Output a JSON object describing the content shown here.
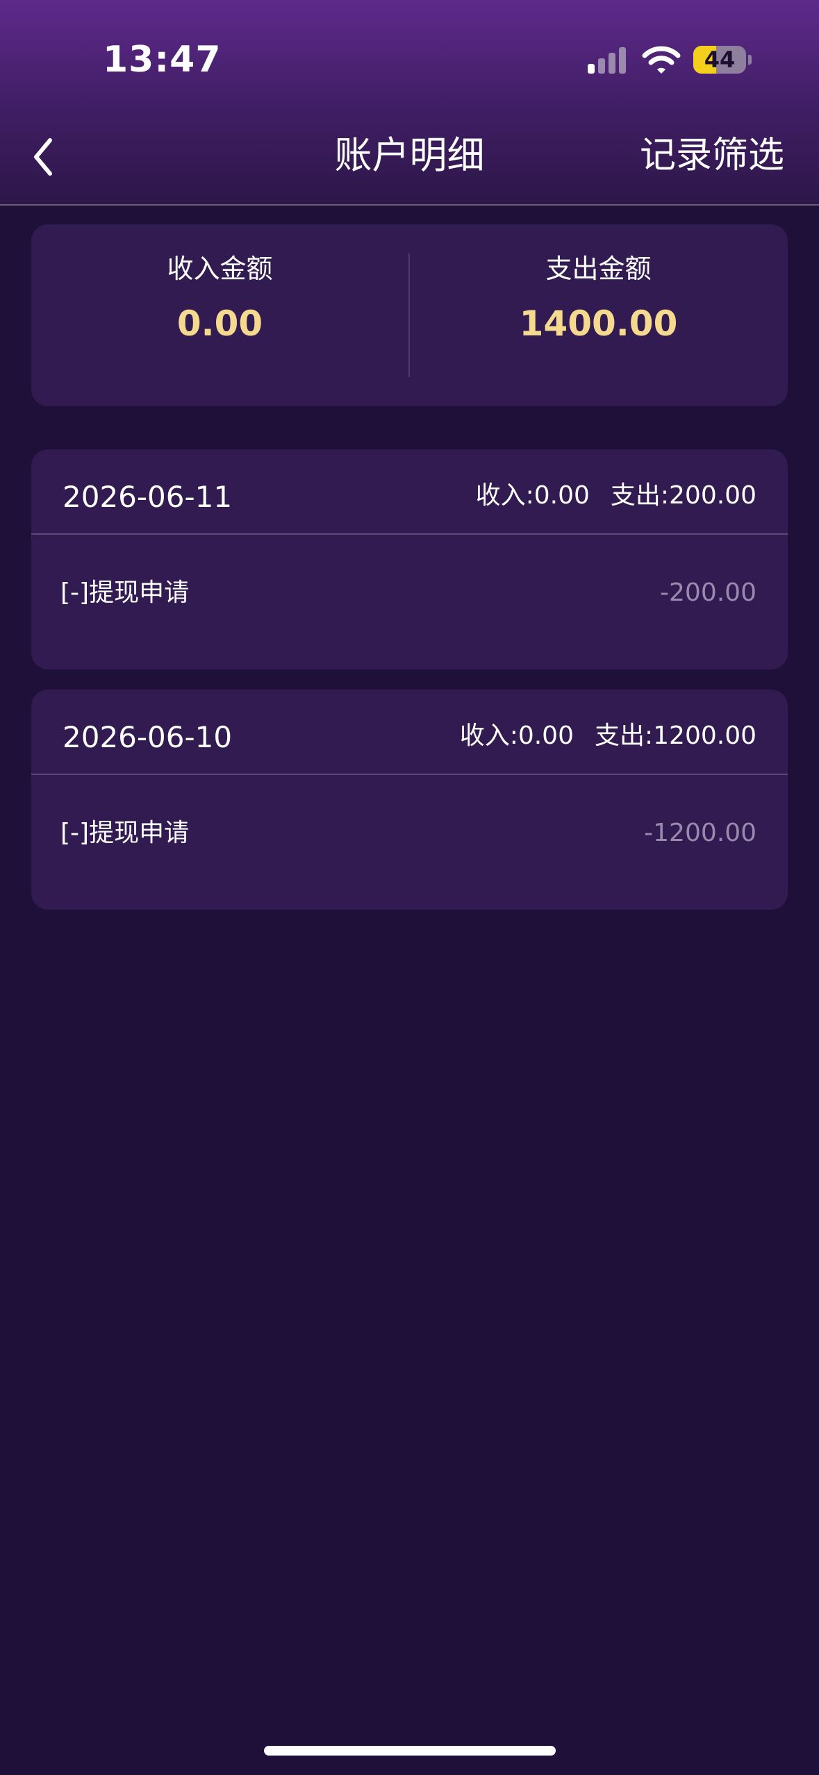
{
  "status_bar": {
    "time": "13:47",
    "battery_level": "44",
    "icons": [
      "signal-icon",
      "wifi-icon",
      "battery-icon"
    ]
  },
  "nav": {
    "back_icon": "chevron-left-icon",
    "title": "账户明细",
    "filter_label": "记录筛选"
  },
  "summary": {
    "income_label": "收入金额",
    "income_value": "0.00",
    "expense_label": "支出金额",
    "expense_value": "1400.00"
  },
  "records": [
    {
      "date": "2026-06-11",
      "income_summary": "收入:0.00",
      "expense_summary": "支出:200.00",
      "items": [
        {
          "description": "[-]提现申请",
          "amount": "-200.00"
        }
      ]
    },
    {
      "date": "2026-06-10",
      "income_summary": "收入:0.00",
      "expense_summary": "支出:1200.00",
      "items": [
        {
          "description": "[-]提现申请",
          "amount": "-1200.00"
        }
      ]
    }
  ],
  "colors": {
    "background": "#1f1039",
    "card": "#321b50",
    "accent_value": "#f4d98f",
    "muted_amount": "#9a8ab0",
    "battery": "#f4d01c"
  }
}
